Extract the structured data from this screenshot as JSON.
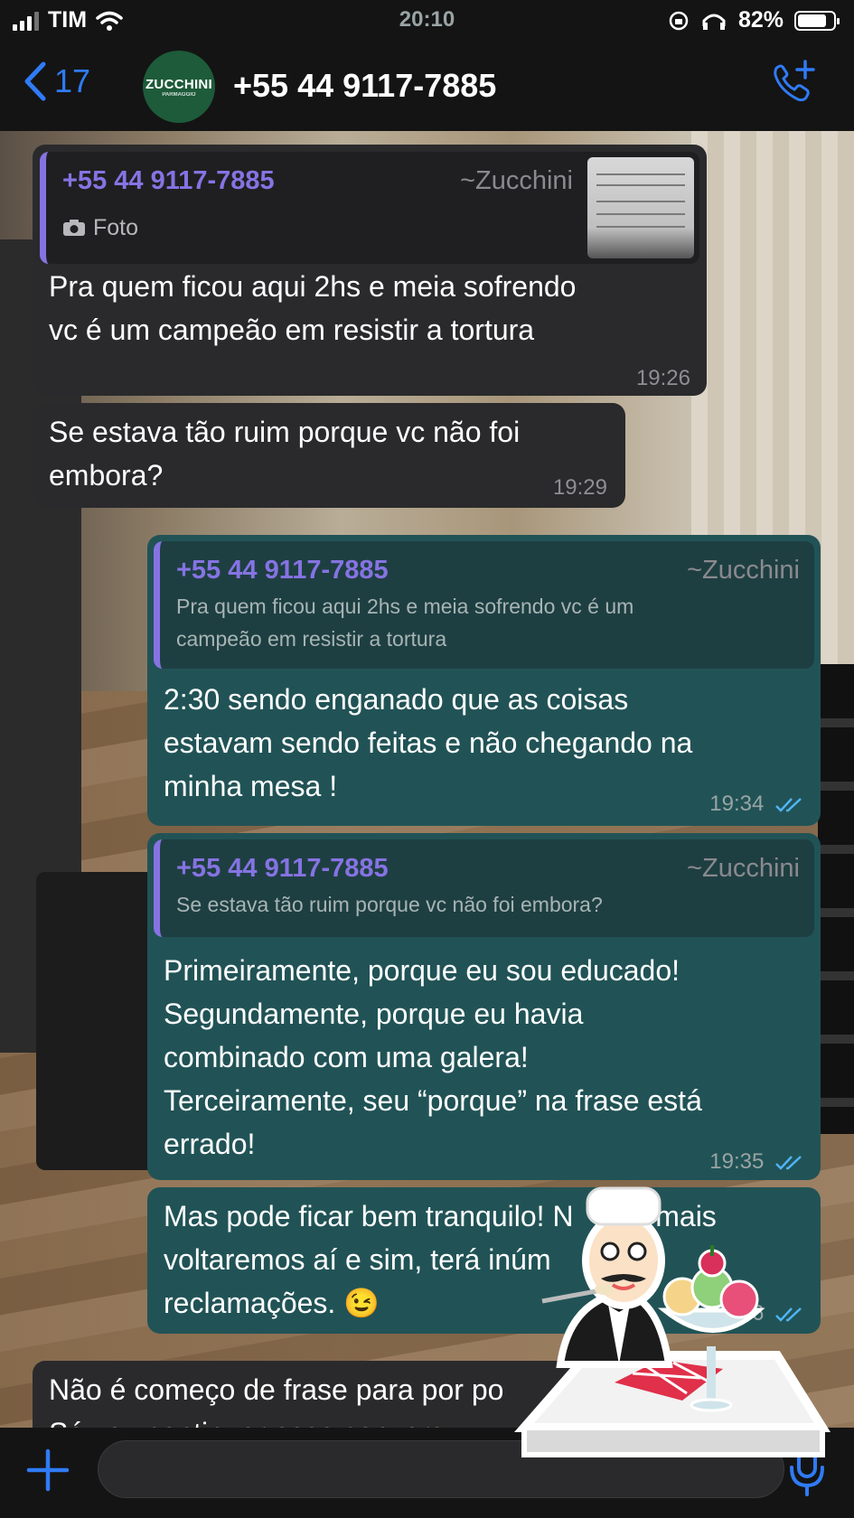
{
  "status": {
    "carrier": "TIM",
    "time": "20:10",
    "battery": "82%",
    "battery_level": 0.82
  },
  "header": {
    "back_count": "17",
    "avatar_logo": "ZUCCHINI",
    "avatar_sub": "PARMAGGIO",
    "contact": "+55 44 9117-7885"
  },
  "messages": [
    {
      "quote_name": "+55 44 9117-7885",
      "quote_alias": "~Zucchini",
      "quote_type": "Foto",
      "text_lines": [
        "Pra quem ficou aqui 2hs e meia sofrendo",
        "vc é um campeão em resistir a tortura"
      ],
      "time": "19:26"
    },
    {
      "text_lines": [
        "Se estava tão ruim porque vc não foi",
        "embora?"
      ],
      "time": "19:29"
    },
    {
      "quote_name": "+55 44 9117-7885",
      "quote_alias": "~Zucchini",
      "quote_lines": [
        "Pra quem ficou aqui 2hs e meia sofrendo vc é um",
        "campeão em resistir a tortura"
      ],
      "text_lines": [
        "2:30 sendo enganado que as coisas",
        "estavam sendo feitas e não chegando na",
        "minha mesa !"
      ],
      "time": "19:34"
    },
    {
      "quote_name": "+55 44 9117-7885",
      "quote_alias": "~Zucchini",
      "quote_lines": [
        "Se estava tão ruim porque vc não foi embora?"
      ],
      "text_lines": [
        "Primeiramente, porque eu sou educado!",
        "Segundamente, porque eu havia",
        "combinado com uma galera!",
        "Terceiramente, seu “porque” na frase está",
        "errado!"
      ],
      "time": "19:35"
    },
    {
      "text_lines": [
        "Mas pode ficar bem tranquilo! N  a mais",
        "voltaremos aí e sim, terá inúm",
        "reclamações. 😉"
      ],
      "time": "36"
    },
    {
      "text_lines": [
        "Não é começo de frase para por po",
        "Só vou continuar essa convers"
      ]
    }
  ]
}
